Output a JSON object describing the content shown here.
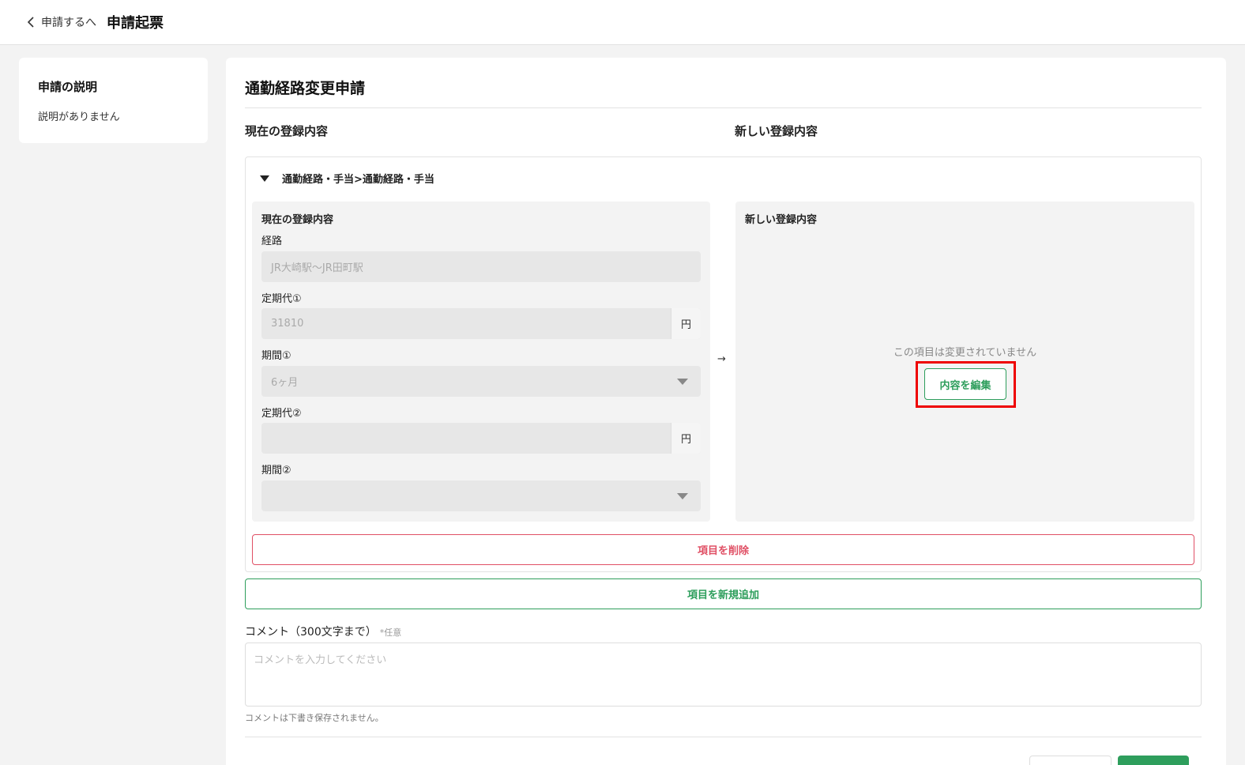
{
  "header": {
    "back_label": "申請するへ",
    "title": "申請起票"
  },
  "sidebar": {
    "title": "申請の説明",
    "description": "説明がありません"
  },
  "form": {
    "title": "通勤経路変更申請",
    "col_current": "現在の登録内容",
    "col_new": "新しい登録内容",
    "section_label": "通勤経路・手当>通勤経路・手当",
    "current_panel": {
      "heading": "現在の登録内容",
      "fields": {
        "route": {
          "label": "経路",
          "value": "JR大崎駅〜JR田町駅"
        },
        "pass_fee_1": {
          "label": "定期代①",
          "value": "31810",
          "unit": "円"
        },
        "period_1": {
          "label": "期間①",
          "value": "6ヶ月"
        },
        "pass_fee_2": {
          "label": "定期代②",
          "value": "",
          "unit": "円"
        },
        "period_2": {
          "label": "期間②",
          "value": ""
        }
      }
    },
    "arrow": "→",
    "new_panel": {
      "heading": "新しい登録内容",
      "unchanged_text": "この項目は変更されていません",
      "edit_label": "内容を編集"
    },
    "delete_label": "項目を削除",
    "add_label": "項目を新規追加",
    "comment": {
      "label": "コメント（300文字まで）",
      "optional": "*任意",
      "placeholder": "コメントを入力してください",
      "value": "",
      "note": "コメントは下書き保存されません。"
    }
  },
  "colors": {
    "accent": "#2e9e5c",
    "danger": "#e05065",
    "highlight": "#e00000"
  }
}
